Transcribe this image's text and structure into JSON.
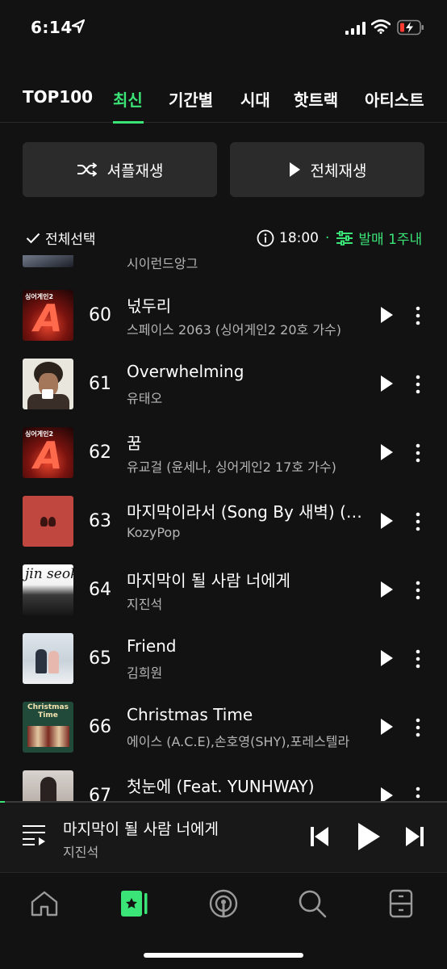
{
  "status_bar": {
    "time": "6:14"
  },
  "tabs": [
    {
      "label": "TOP100",
      "active": false
    },
    {
      "label": "최신",
      "active": true
    },
    {
      "label": "기간별",
      "active": false
    },
    {
      "label": "시대",
      "active": false
    },
    {
      "label": "핫트랙",
      "active": false
    },
    {
      "label": "아티스트",
      "active": false
    }
  ],
  "actions": {
    "shuffle_label": "셔플재생",
    "play_all_label": "전체재생"
  },
  "list_header": {
    "select_all_label": "전체선택",
    "updated_time": "18:00",
    "filter_label": "발매 1주내"
  },
  "partial_top_artist": "시이런드앙그",
  "songs": [
    {
      "rank": "60",
      "title": "넋두리",
      "artist": "스페이스 2063 (싱어게인2 20호 가수)"
    },
    {
      "rank": "61",
      "title": "Overwhelming",
      "artist": "유태오"
    },
    {
      "rank": "62",
      "title": "꿈",
      "artist": "유교걸 (윤세나, 싱어게인2 17호 가수)"
    },
    {
      "rank": "63",
      "title": "마지막이라서 (Song By 새벽) (Prod. KozyPop)",
      "artist": "KozyPop"
    },
    {
      "rank": "64",
      "title": "마지막이 될 사람 너에게",
      "artist": "지진석"
    },
    {
      "rank": "65",
      "title": "Friend",
      "artist": "김희원"
    },
    {
      "rank": "66",
      "title": "Christmas Time",
      "artist": "에이스 (A.C.E),손호영(SHY),포레스텔라"
    },
    {
      "rank": "67",
      "title": "첫눈에 (Feat. YUNHWAY)",
      "artist": ""
    }
  ],
  "album_art": {
    "a60": {
      "line1": "싱어게인2",
      "letter": "A"
    },
    "a62": {
      "line1": "싱어게인2",
      "letter": "A"
    },
    "a64": {
      "script": "jin seok"
    },
    "a66": {
      "line1": "Christmas",
      "line2": "Time"
    }
  },
  "now_playing": {
    "title": "마지막이 될 사람 너에게",
    "artist": "지진석",
    "progress": 0.01
  },
  "colors": {
    "accent": "#3be477",
    "background": "#121212",
    "button_bg": "#2b2b2b",
    "secondary_text": "#b5b5b5"
  },
  "nav_icons": [
    "home-icon",
    "my-music-icon",
    "podcast-icon",
    "search-icon",
    "library-icon"
  ]
}
